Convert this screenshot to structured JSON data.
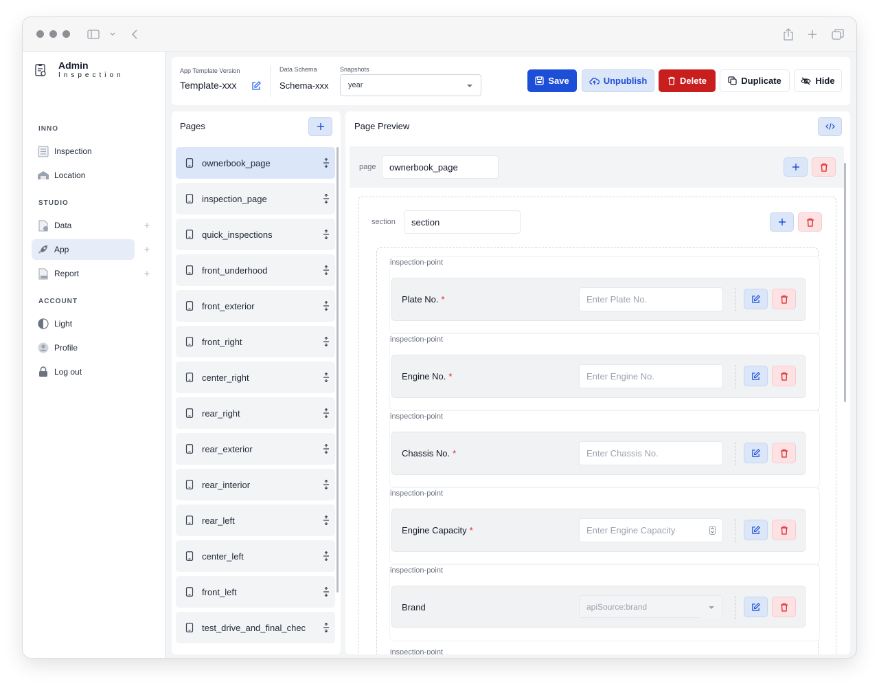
{
  "sidebar": {
    "brand": {
      "title": "Admin",
      "subtitle": "Inspection"
    },
    "sections": [
      {
        "heading": "INNO"
      },
      {
        "heading": "STUDIO"
      },
      {
        "heading": "ACCOUNT"
      }
    ],
    "items": [
      {
        "label": "Inspection",
        "icon": "list-icon"
      },
      {
        "label": "Location",
        "icon": "building-icon"
      },
      {
        "label": "Data",
        "icon": "data-file-icon"
      },
      {
        "label": "App",
        "icon": "rocket-icon"
      },
      {
        "label": "Report",
        "icon": "pdf-icon"
      },
      {
        "label": "Light",
        "icon": "theme-half-icon"
      },
      {
        "label": "Profile",
        "icon": "user-icon"
      },
      {
        "label": "Log out",
        "icon": "lock-icon"
      }
    ]
  },
  "topbar": {
    "template_label": "App Template Version",
    "template_value": "Template-xxx",
    "schema_label": "Data Schema",
    "schema_value": "Schema-xxx",
    "snapshots_label": "Snapshots",
    "snapshots_value": "year",
    "buttons": {
      "save": "Save",
      "unpublish": "Unpublish",
      "delete": "Delete",
      "duplicate": "Duplicate",
      "hide": "Hide"
    }
  },
  "pages_panel": {
    "title": "Pages",
    "items": [
      "ownerbook_page",
      "inspection_page",
      "quick_inspections",
      "front_underhood",
      "front_exterior",
      "front_right",
      "center_right",
      "rear_right",
      "rear_exterior",
      "rear_interior",
      "rear_left",
      "center_left",
      "front_left",
      "test_drive_and_final_chec"
    ],
    "active": "ownerbook_page"
  },
  "preview": {
    "title": "Page Preview",
    "page_label": "page",
    "page_value": "ownerbook_page",
    "section_label": "section",
    "section_value": "section",
    "points": [
      {
        "label": "inspection-point",
        "name": "Plate No.",
        "required": "*",
        "placeholder": "Enter Plate No."
      },
      {
        "label": "inspection-point",
        "name": "Engine No.",
        "required": "*",
        "placeholder": "Enter Engine No."
      },
      {
        "label": "inspection-point",
        "name": "Chassis No.",
        "required": "*",
        "placeholder": "Enter Chassis No."
      },
      {
        "label": "inspection-point",
        "name": "Engine Capacity",
        "required": "*",
        "placeholder": "Enter Engine Capacity"
      },
      {
        "label": "inspection-point",
        "name": "Brand",
        "required": "",
        "placeholder": "apiSource:brand"
      }
    ],
    "next_point_label": "inspection-point"
  },
  "colors": {
    "primary": "#1d4ed8",
    "danger": "#c81e1e",
    "active_bg": "#dbe6f8"
  }
}
